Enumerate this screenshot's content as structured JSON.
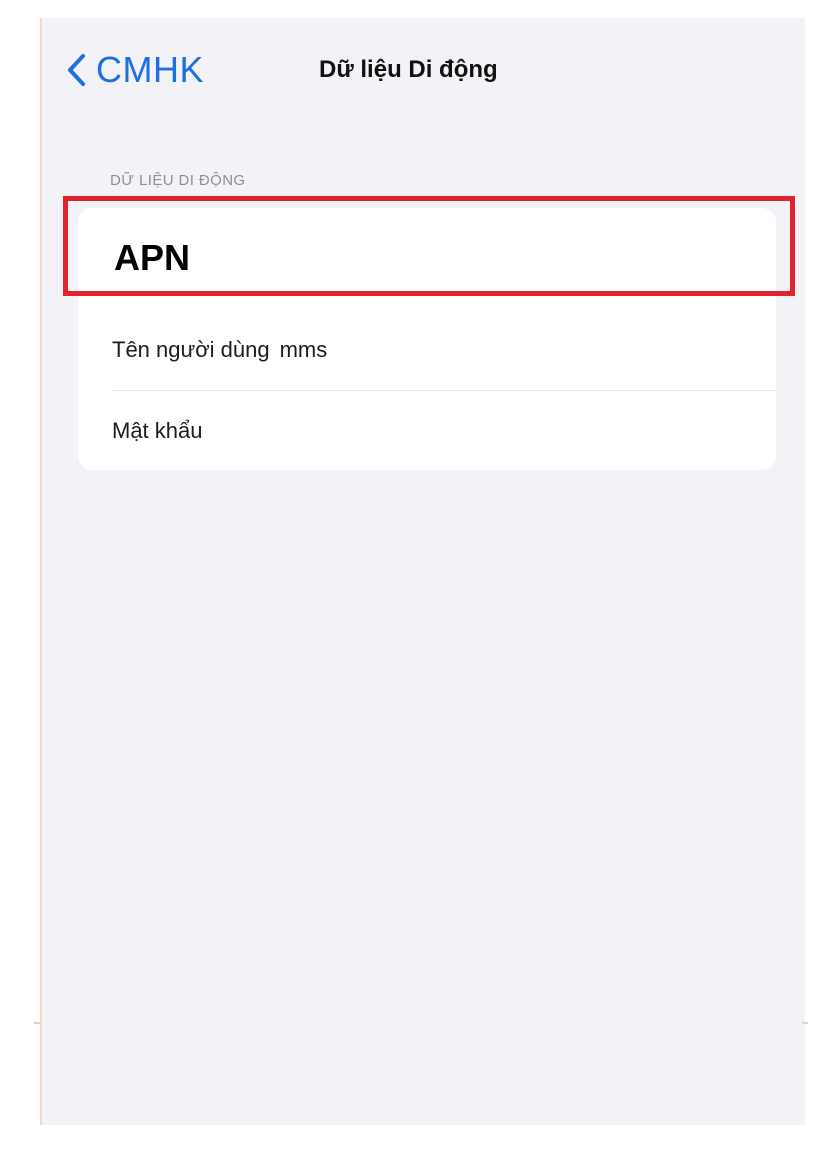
{
  "nav": {
    "back_label": "CMHK",
    "title": "Dữ liệu Di động"
  },
  "section": {
    "header": "DỮ LIỆU DI ĐỘNG"
  },
  "settings": {
    "apn_label": "APN",
    "username_label": "Tên người dùng",
    "username_value": "mms",
    "password_label": "Mật khẩu"
  },
  "icons": {
    "back": "chevron-left-icon"
  },
  "colors": {
    "accent": "#1f6fe0",
    "highlight": "#e0232e",
    "background": "#f2f2f7",
    "card": "#ffffff",
    "secondary_text": "#8e8e93"
  }
}
